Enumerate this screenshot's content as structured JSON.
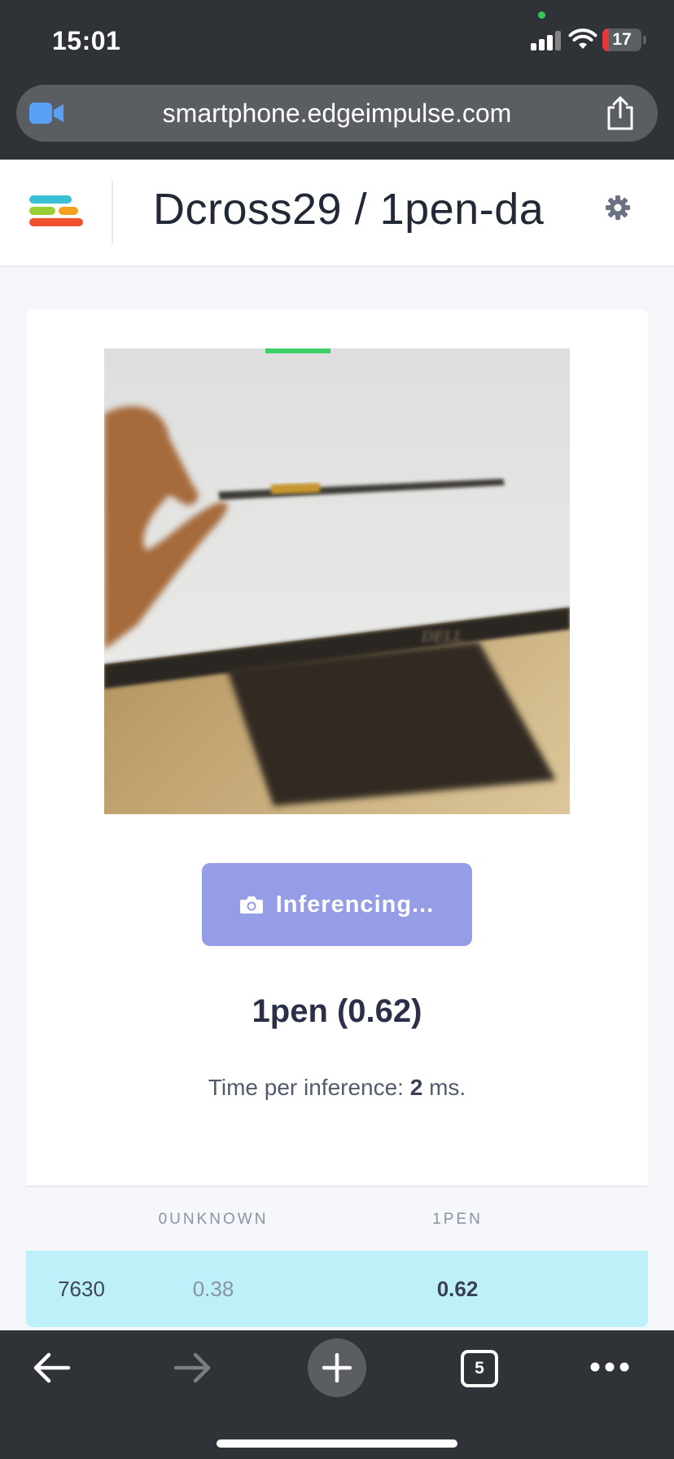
{
  "status_bar": {
    "time": "15:01",
    "battery_level": "17",
    "battery_fraction": 0.17,
    "icons": [
      "camera-in-use-dot",
      "cellular-signal-icon",
      "wifi-icon",
      "battery-icon"
    ]
  },
  "browser": {
    "url": "smartphone.edgeimpulse.com",
    "tab_count": "5",
    "icons": [
      "video-icon",
      "share-icon",
      "back-arrow-icon",
      "forward-arrow-icon",
      "plus-icon",
      "tabs-icon",
      "more-icon"
    ]
  },
  "header": {
    "project_title": "Dcross29 / 1pen-da",
    "icons": [
      "edge-impulse-logo",
      "gear-icon"
    ]
  },
  "capture": {
    "button_label": "Inferencing...",
    "button_icon": "camera-icon"
  },
  "result": {
    "label": "1pen (0.62)",
    "timing_prefix": "Time per inference: ",
    "timing_value": "2",
    "timing_suffix": " ms."
  },
  "table": {
    "headers": [
      "",
      "0UNKNOWN",
      "1PEN"
    ],
    "rows": [
      {
        "id": "7630",
        "unknown": "0.38",
        "pen": "0.62"
      }
    ]
  },
  "colors": {
    "chrome_dark": "#2f3236",
    "button_bg": "#949de6",
    "row_highlight": "#bdf0f8",
    "logo_teal": "#3bbfd2",
    "logo_green": "#9acd32",
    "logo_orange": "#f4a11f",
    "logo_red": "#f0502e"
  }
}
